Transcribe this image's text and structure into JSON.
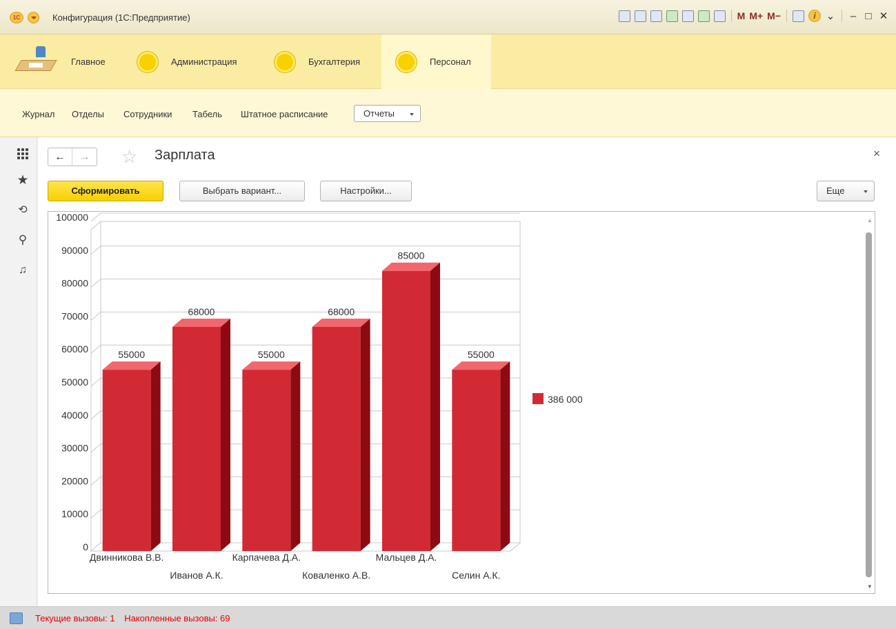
{
  "window": {
    "title": "Конфигурация  (1С:Предприятие)",
    "logo_text": "1С"
  },
  "titlebar_icons": [
    "save-icon",
    "print-icon",
    "preview-icon",
    "upload-icon",
    "attach-icon",
    "calculator-icon",
    "calendar-icon"
  ],
  "memory_buttons": [
    "M",
    "M+",
    "M−"
  ],
  "sections": [
    {
      "label": "Главное",
      "icon": "desk-icon",
      "active": false
    },
    {
      "label": "Администрация",
      "icon": "section-circle-icon",
      "active": false
    },
    {
      "label": "Бухгалтерия",
      "icon": "section-circle-icon",
      "active": false
    },
    {
      "label": "Персонал",
      "icon": "section-circle-icon",
      "active": true
    }
  ],
  "subpanel": {
    "items": [
      "Журнал",
      "Отделы",
      "Сотрудники",
      "Табель",
      "Штатное расписание"
    ],
    "reports_label": "Отчеты"
  },
  "left_toolbar": [
    "apps-icon",
    "favorites-star-icon",
    "history-icon",
    "search-icon",
    "notifications-bell-icon"
  ],
  "form": {
    "title": "Зарплата",
    "back_icon": "←",
    "forward_icon": "→",
    "favorite_icon": "☆",
    "close_icon": "×",
    "buttons": {
      "generate": "Сформировать",
      "choose_variant": "Выбрать вариант...",
      "settings": "Настройки...",
      "more": "Еще"
    }
  },
  "chart_data": {
    "type": "bar",
    "style": "3d",
    "categories": [
      "Двинникова В.В.",
      "Иванов А.К.",
      "Карпачева Д.А.",
      "Коваленко А.В.",
      "Мальцев Д.А.",
      "Селин А.К."
    ],
    "values": [
      55000,
      68000,
      55000,
      68000,
      85000,
      55000
    ],
    "data_labels": [
      "55000",
      "68000",
      "55000",
      "68000",
      "85000",
      "55000"
    ],
    "y_ticks": [
      "0",
      "10000",
      "20000",
      "30000",
      "40000",
      "50000",
      "60000",
      "70000",
      "80000",
      "90000",
      "100000"
    ],
    "ylim": [
      0,
      100000
    ],
    "grid": true,
    "legend": [
      {
        "label": "386 000",
        "color": "#d12a35"
      }
    ],
    "legend_position": "right",
    "colors": {
      "front": "#d12a35",
      "top": "#f2666d",
      "side": "#8e0a12"
    }
  },
  "status": {
    "current_calls": "Текущие вызовы: 1",
    "accumulated_calls": "Накопленные вызовы: 69"
  }
}
